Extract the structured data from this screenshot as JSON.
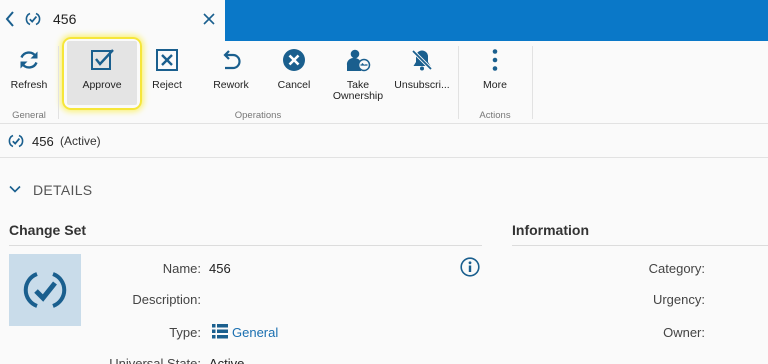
{
  "tab": {
    "title": "456"
  },
  "ribbon": {
    "buttons": {
      "refresh": "Refresh",
      "approve": "Approve",
      "reject": "Reject",
      "rework": "Rework",
      "cancel": "Cancel",
      "take_ownership_1": "Take",
      "take_ownership_2": "Ownership",
      "unsubscribe": "Unsubscri...",
      "more": "More"
    },
    "groups": {
      "general": "General",
      "operations": "Operations",
      "actions": "Actions"
    }
  },
  "record": {
    "id": "456",
    "state": "(Active)"
  },
  "details": {
    "header": "DETAILS",
    "change_set": {
      "title": "Change Set",
      "fields": {
        "name_label": "Name:",
        "name_value": "456",
        "description_label": "Description:",
        "description_value": "",
        "type_label": "Type:",
        "type_value": "General",
        "universal_state_label": "Universal State:",
        "universal_state_value": "Active"
      }
    },
    "information": {
      "title": "Information",
      "fields": {
        "category_label": "Category:",
        "urgency_label": "Urgency:",
        "owner_label": "Owner:"
      }
    }
  },
  "colors": {
    "accent": "#0a78c8",
    "icon": "#1a5f8e",
    "highlight": "#f6e63a",
    "thumb_bg": "#c9dcea"
  },
  "icons": [
    "back-icon",
    "check-circle-icon",
    "close-icon",
    "refresh-icon",
    "approve-icon",
    "reject-icon",
    "rework-icon",
    "cancel-icon",
    "take-ownership-icon",
    "unsubscribe-icon",
    "more-icon",
    "chevron-down-icon",
    "info-icon",
    "list-icon"
  ]
}
